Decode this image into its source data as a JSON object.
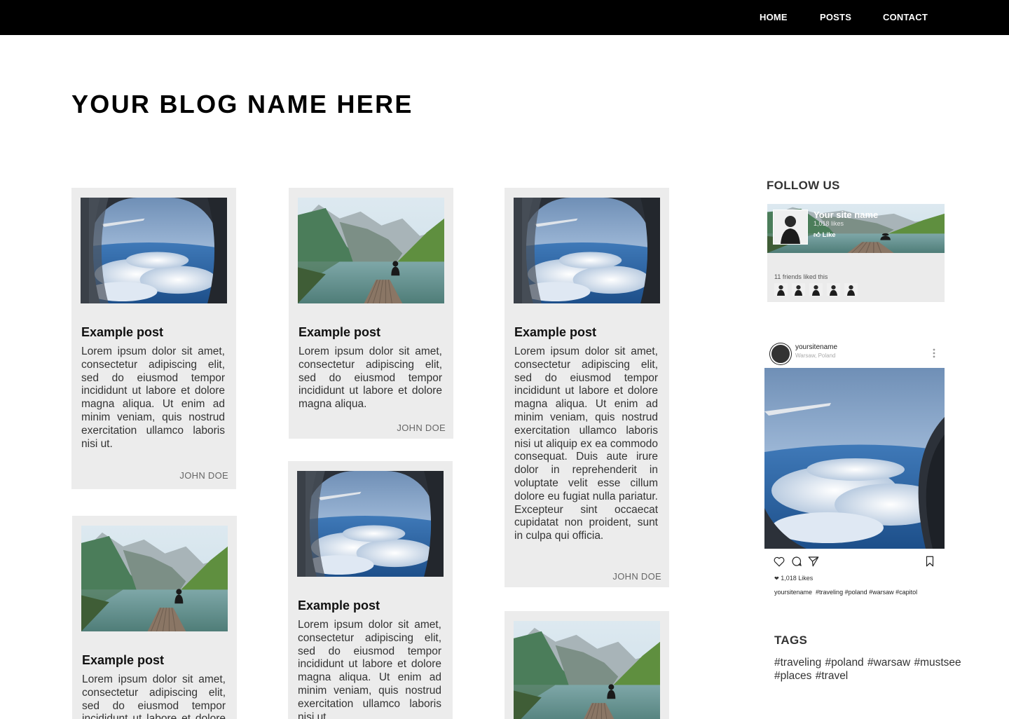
{
  "nav": {
    "home": "HOME",
    "posts": "POSTS",
    "contact": "CONTACT"
  },
  "blog_title": "YOUR BLOG NAME HERE",
  "posts": [
    {
      "image": "airplane-window",
      "title": "Example post",
      "body": "Lorem ipsum dolor sit amet, consectetur adipiscing elit, sed do eiusmod tempor incididunt ut labore et dolore magna aliqua. Ut enim ad minim veniam, quis nostrud exercitation ullamco laboris nisi ut.",
      "author": "JOHN DOE"
    },
    {
      "image": "mountain-lake",
      "title": "Example post",
      "body": "Lorem ipsum dolor sit amet, consectetur adipiscing elit, sed do eiusmod tempor incididunt ut labore et dolore magna aliqua.",
      "author": "JOHN DOE"
    },
    {
      "image": "airplane-window",
      "title": "Example post",
      "body": "Lorem ipsum dolor sit amet, consectetur adipiscing elit, sed do eiusmod tempor incididunt ut labore et dolore magna aliqua. Ut enim ad minim veniam, quis nostrud exercitation ullamco laboris nisi ut aliquip ex ea commodo consequat. Duis aute irure dolor in reprehenderit in voluptate velit esse cillum dolore eu fugiat nulla pariatur. Excepteur sint occaecat cupidatat non proident, sunt in culpa qui officia.",
      "author": "JOHN DOE"
    },
    {
      "image": "mountain-lake",
      "title": "Example post",
      "body": "Lorem ipsum dolor sit amet, consectetur adipiscing elit, sed do eiusmod tempor incididunt ut labore et dolore magna aliqua.",
      "author": ""
    },
    {
      "image": "airplane-window",
      "title": "Example post",
      "body": "Lorem ipsum dolor sit amet, consectetur adipiscing elit, sed do eiusmod tempor incididunt ut labore et dolore magna aliqua. Ut enim ad minim veniam, quis nostrud exercitation ullamco laboris nisi ut.",
      "author": ""
    },
    {
      "image": "mountain-lake",
      "title": "",
      "body": "",
      "author": ""
    }
  ],
  "follow": {
    "heading": "FOLLOW US",
    "page_name": "Your site name",
    "likes": "1,018 likes",
    "like_button": "Like",
    "friends_text": "11 friends liked this",
    "friend_count_shown": 5
  },
  "instagram": {
    "username": "yoursitename",
    "location": "Warsaw, Poland",
    "likes": "1,018 Likes",
    "caption_user": "yoursitename",
    "caption_tags": "#traveling #poland #warsaw #capitol",
    "icons": [
      "heart-icon",
      "comment-icon",
      "share-icon",
      "bookmark-icon"
    ]
  },
  "tags": {
    "heading": "TAGS",
    "text": "#traveling #poland #warsaw #mustsee #places #travel"
  }
}
